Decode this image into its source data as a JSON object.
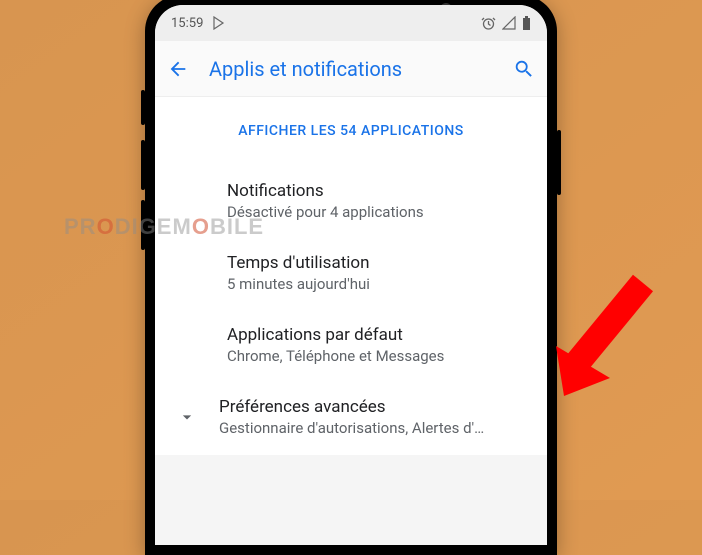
{
  "status": {
    "time": "15:59"
  },
  "appbar": {
    "title": "Applis et notifications"
  },
  "section_header": "AFFICHER LES 54 APPLICATIONS",
  "items": [
    {
      "title": "Notifications",
      "sub": "Désactivé pour 4 applications"
    },
    {
      "title": "Temps d'utilisation",
      "sub": "5 minutes aujourd'hui"
    },
    {
      "title": "Applications par défaut",
      "sub": "Chrome, Téléphone et Messages"
    },
    {
      "title": "Préférences avancées",
      "sub": "Gestionnaire d'autorisations, Alertes d'…"
    }
  ],
  "watermark": {
    "pre": "PR",
    "accent": "O",
    "post": "DIGEM",
    "accent2": "O",
    "post2": "BILE"
  }
}
